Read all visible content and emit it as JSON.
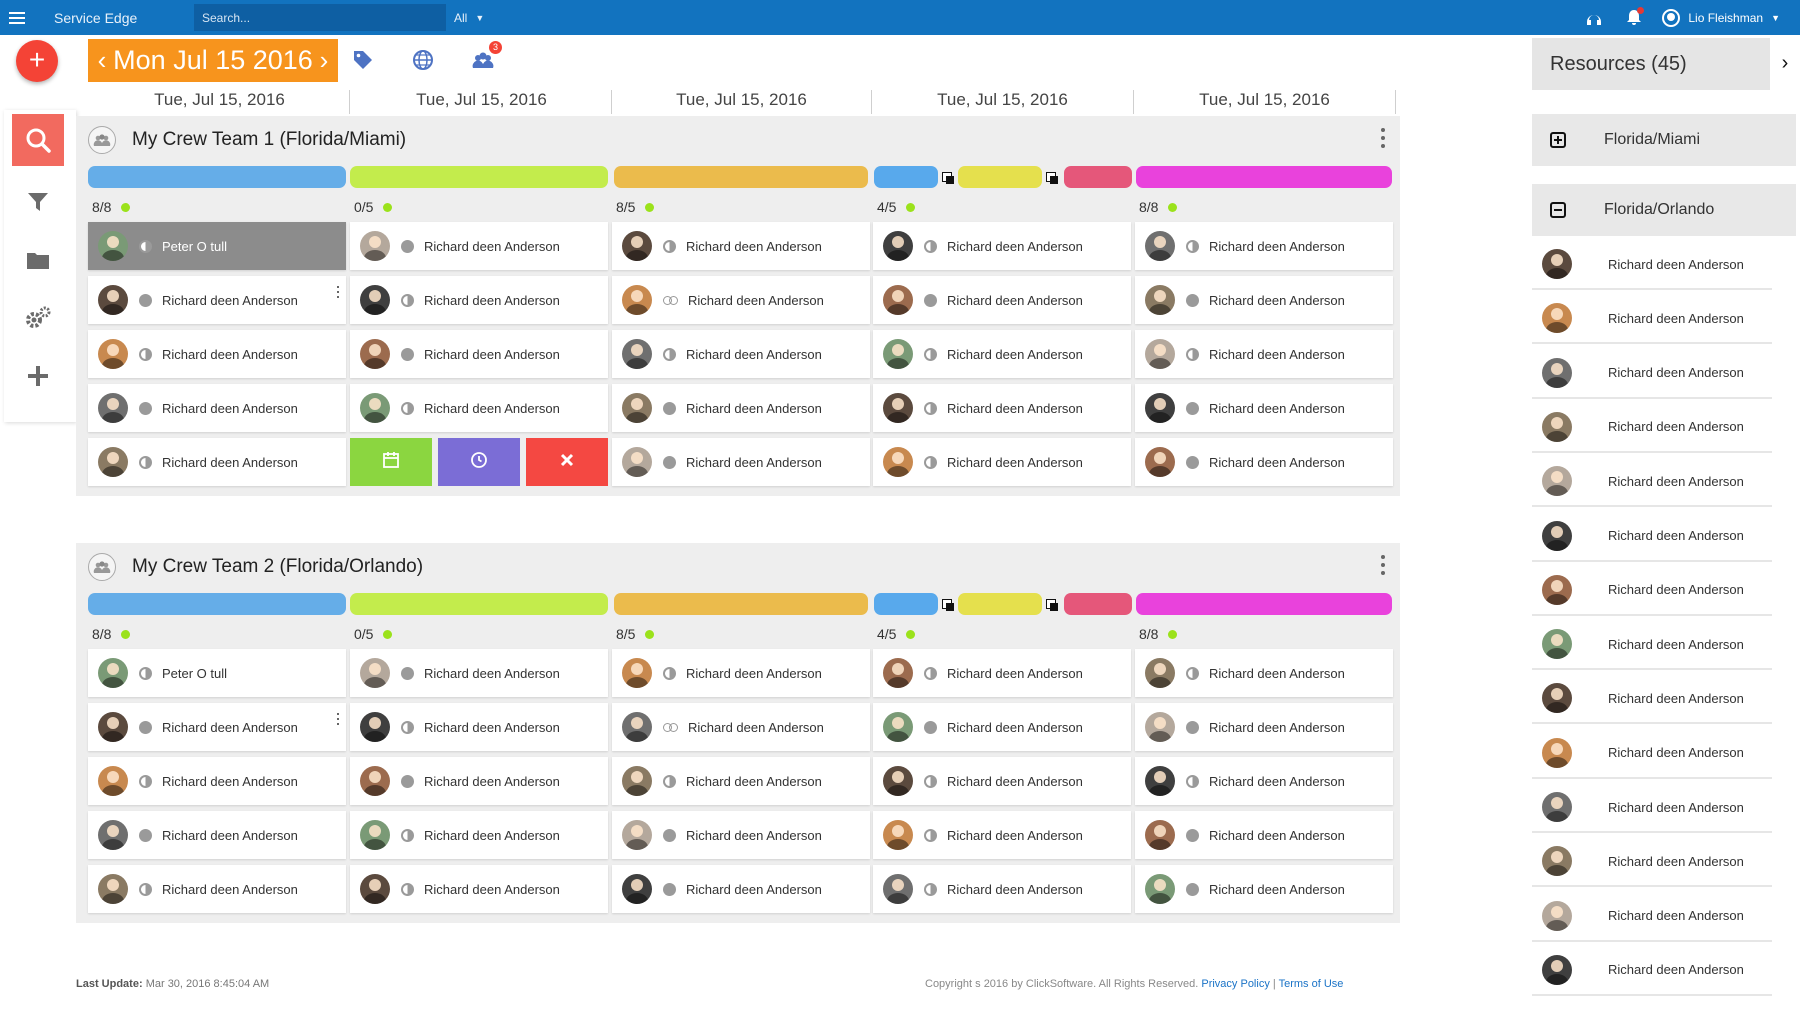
{
  "topbar": {
    "app_title": "Service Edge",
    "search_placeholder": "Search...",
    "scope": "All",
    "user_name": "Lio Fleishman"
  },
  "toolbar": {
    "add_symbol": "+",
    "prev_symbol": "‹",
    "next_symbol": "›",
    "current_date": "Mon Jul 15 2016",
    "team_badge": "3"
  },
  "day_headers": [
    "Tue, Jul 15, 2016",
    "Tue, Jul 15, 2016",
    "Tue, Jul 15, 2016",
    "Tue, Jul 15, 2016",
    "Tue, Jul 15, 2016"
  ],
  "crews": [
    {
      "title": "My Crew Team 1 (Florida/Miami)",
      "capacities": [
        "8/8",
        "0/5",
        "8/5",
        "4/5",
        "8/8"
      ],
      "bar_colors": [
        "#65ade8",
        "#c3ec4c",
        "#ebbb4c",
        "#58a9ec",
        "#e5e04d",
        "#e5577a",
        "#e942dc"
      ],
      "columns": [
        [
          {
            "name": "Peter O tull",
            "status": "half",
            "selected": true
          },
          {
            "name": "Richard deen Anderson",
            "status": "full",
            "menu": true
          },
          {
            "name": "Richard deen Anderson",
            "status": "half"
          },
          {
            "name": "Richard deen Anderson",
            "status": "full"
          },
          {
            "name": "Richard deen Anderson",
            "status": "half"
          }
        ],
        [
          {
            "name": "Richard deen Anderson",
            "status": "full"
          },
          {
            "name": "Richard deen Anderson",
            "status": "half"
          },
          {
            "name": "Richard deen Anderson",
            "status": "full"
          },
          {
            "name": "Richard deen Anderson",
            "status": "half"
          }
        ],
        [
          {
            "name": "Richard deen Anderson",
            "status": "half"
          },
          {
            "name": "Richard deen Anderson",
            "status": "link"
          },
          {
            "name": "Richard deen Anderson",
            "status": "half"
          },
          {
            "name": "Richard deen Anderson",
            "status": "full"
          },
          {
            "name": "Richard deen Anderson",
            "status": "full"
          }
        ],
        [
          {
            "name": "Richard deen Anderson",
            "status": "half"
          },
          {
            "name": "Richard deen Anderson",
            "status": "full"
          },
          {
            "name": "Richard deen Anderson",
            "status": "half"
          },
          {
            "name": "Richard deen Anderson",
            "status": "half"
          },
          {
            "name": "Richard deen Anderson",
            "status": "half"
          }
        ],
        [
          {
            "name": "Richard deen Anderson",
            "status": "half"
          },
          {
            "name": "Richard deen Anderson",
            "status": "full"
          },
          {
            "name": "Richard deen Anderson",
            "status": "half"
          },
          {
            "name": "Richard deen Anderson",
            "status": "full"
          },
          {
            "name": "Richard deen Anderson",
            "status": "full"
          }
        ]
      ],
      "actions": [
        {
          "icon": "calendar-icon",
          "color": "#8bd640"
        },
        {
          "icon": "clock-icon",
          "color": "#7b6dd6"
        },
        {
          "icon": "close-icon",
          "color": "#f44842"
        }
      ]
    },
    {
      "title": "My Crew Team 2 (Florida/Orlando)",
      "capacities": [
        "8/8",
        "0/5",
        "8/5",
        "4/5",
        "8/8"
      ],
      "bar_colors": [
        "#65ade8",
        "#c3ec4c",
        "#ebbb4c",
        "#58a9ec",
        "#e5e04d",
        "#e5577a",
        "#e942dc"
      ],
      "columns": [
        [
          {
            "name": "Peter O tull",
            "status": "half"
          },
          {
            "name": "Richard deen Anderson",
            "status": "full",
            "menu": true
          },
          {
            "name": "Richard deen Anderson",
            "status": "half"
          },
          {
            "name": "Richard deen Anderson",
            "status": "full"
          },
          {
            "name": "Richard deen Anderson",
            "status": "half"
          }
        ],
        [
          {
            "name": "Richard deen Anderson",
            "status": "full"
          },
          {
            "name": "Richard deen Anderson",
            "status": "half"
          },
          {
            "name": "Richard deen Anderson",
            "status": "full"
          },
          {
            "name": "Richard deen Anderson",
            "status": "half"
          },
          {
            "name": "Richard deen Anderson",
            "status": "half"
          }
        ],
        [
          {
            "name": "Richard deen Anderson",
            "status": "half"
          },
          {
            "name": "Richard deen Anderson",
            "status": "link"
          },
          {
            "name": "Richard deen Anderson",
            "status": "half"
          },
          {
            "name": "Richard deen Anderson",
            "status": "full"
          },
          {
            "name": "Richard deen Anderson",
            "status": "full"
          }
        ],
        [
          {
            "name": "Richard deen Anderson",
            "status": "half"
          },
          {
            "name": "Richard deen Anderson",
            "status": "full"
          },
          {
            "name": "Richard deen Anderson",
            "status": "half"
          },
          {
            "name": "Richard deen Anderson",
            "status": "half"
          },
          {
            "name": "Richard deen Anderson",
            "status": "half"
          }
        ],
        [
          {
            "name": "Richard deen Anderson",
            "status": "half"
          },
          {
            "name": "Richard deen Anderson",
            "status": "full"
          },
          {
            "name": "Richard deen Anderson",
            "status": "half"
          },
          {
            "name": "Richard deen Anderson",
            "status": "full"
          },
          {
            "name": "Richard deen Anderson",
            "status": "full"
          }
        ]
      ],
      "actions": []
    }
  ],
  "avatar_tones": [
    "#7a9a76",
    "#5b4a3e",
    "#c8894f",
    "#6f6f6f",
    "#8a7a63",
    "#b4a89c",
    "#3f3f3f",
    "#9c6b4e"
  ],
  "resources": {
    "header": "Resources (45)",
    "toggle_symbol": "›",
    "regions": [
      {
        "label": "Florida/Miami",
        "state": "collapsed"
      },
      {
        "label": "Florida/Orlando",
        "state": "expanded"
      }
    ],
    "items": [
      "Richard deen Anderson",
      "Richard deen Anderson",
      "Richard deen Anderson",
      "Richard deen Anderson",
      "Richard deen Anderson",
      "Richard deen Anderson",
      "Richard deen Anderson",
      "Richard deen Anderson",
      "Richard deen Anderson",
      "Richard deen Anderson",
      "Richard deen Anderson",
      "Richard deen Anderson",
      "Richard deen Anderson",
      "Richard deen Anderson"
    ]
  },
  "footer": {
    "last_update_label": "Last Update:",
    "last_update_value": "Mar 30, 2016 8:45:04 AM",
    "copyright": "Copyright s 2016 by ClickSoftware. All Rights Reserved.",
    "privacy": "Privacy Policy",
    "separator": "|",
    "terms": "Terms of Use"
  }
}
